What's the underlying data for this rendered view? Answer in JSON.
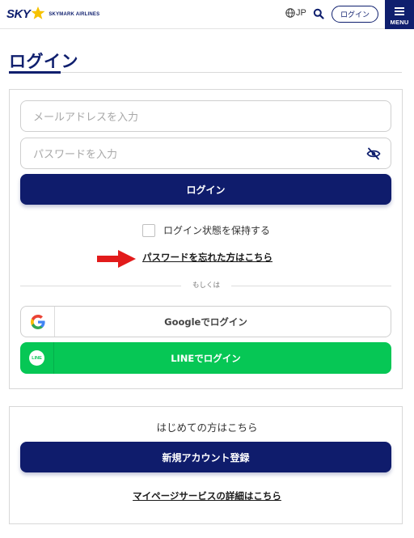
{
  "header": {
    "logo_main": "SKY",
    "logo_sub": "SKYMARK AIRLINES",
    "lang_label": "JP",
    "login_label": "ログイン",
    "menu_label": "MENU"
  },
  "page": {
    "title": "ログイン"
  },
  "login_form": {
    "email_placeholder": "メールアドレスを入力",
    "password_placeholder": "パスワードを入力",
    "submit_label": "ログイン",
    "remember_label": "ログイン状態を保持する",
    "forgot_link": "パスワードを忘れた方はこちら",
    "or_label": "もしくは",
    "google_label": "Googleでログイン",
    "line_label": "LINEでログイン",
    "line_icon_text": "LINE"
  },
  "register": {
    "heading": "はじめての方はこちら",
    "button_label": "新規アカウント登録",
    "details_link": "マイページサービスの詳細はこちら"
  },
  "colors": {
    "brand_navy": "#0f1c6c",
    "line_green": "#06c755",
    "annotation_arrow": "#e21b1b"
  },
  "icons": [
    "star-logo-icon",
    "globe-icon",
    "search-icon",
    "hamburger-icon",
    "eye-off-icon",
    "google-icon",
    "line-icon",
    "red-arrow-icon"
  ]
}
